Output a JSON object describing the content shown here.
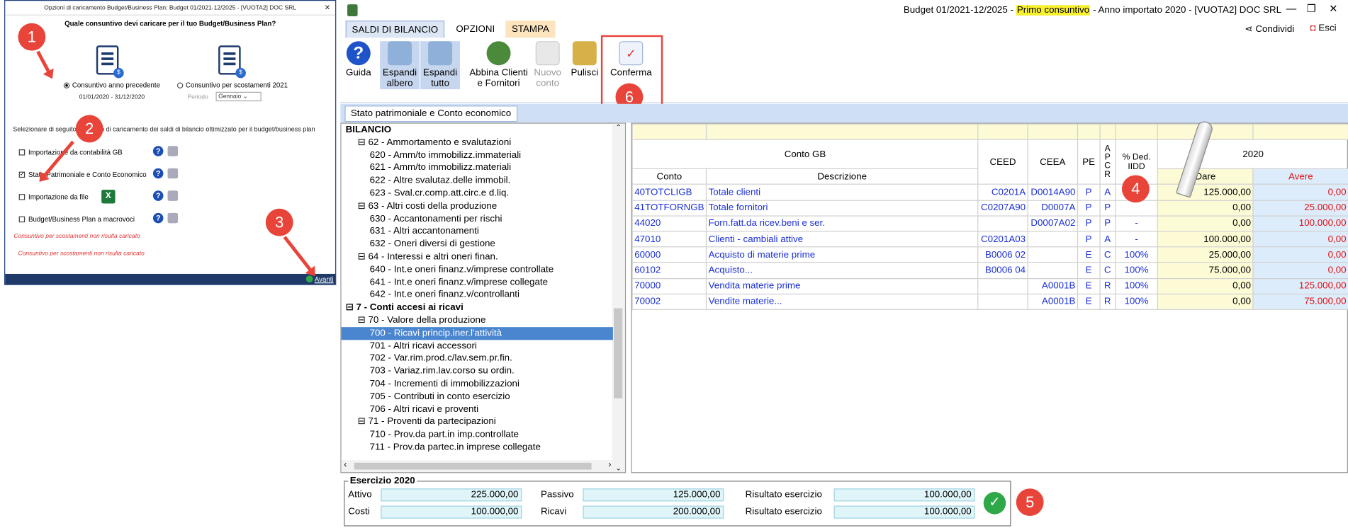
{
  "dialog": {
    "title": "Opzioni di caricamento Budget/Business Plan: Budget 01/2021-12/2025 - [VUOTA2] DOC SRL",
    "close": "×",
    "question": "Quale consuntivo devi caricare per il tuo Budget/Business Plan?",
    "option1_label": "Consuntivo anno precedente",
    "option1_dates": "01/01/2020 - 31/12/2020",
    "option2_label": "Consuntivo per scostamenti 2021",
    "periodo_label": "Periodo",
    "periodo_value": "Gennaio",
    "instruction": "Selezionare di seguito il metodo di caricamento dei saldi di bilancio ottimizzato per il budget/business plan",
    "options": [
      {
        "label": "Importazione da contabilità GB",
        "checked": false
      },
      {
        "label": "Stato Patrimoniale e Conto Economico",
        "checked": true
      },
      {
        "label": "Importazione da file",
        "checked": false
      },
      {
        "label": "Budget/Business Plan a macrovoci",
        "checked": false
      }
    ],
    "note1": "Consuntivo per scostamenti non risulta caricato",
    "note2": "Consuntivo per scostamenti non risulta caricato",
    "avanti": "Avanti"
  },
  "badges": [
    "1",
    "2",
    "3",
    "4",
    "5",
    "6"
  ],
  "app": {
    "title_pre": "Budget 01/2021-12/2025 - ",
    "title_highlight": "Primo consuntivo",
    "title_post": " - Anno importato 2020 - [VUOTA2] DOC SRL",
    "tabs": [
      "SALDI DI BILANCIO",
      "OPZIONI",
      "STAMPA"
    ],
    "share": "Condividi",
    "exit": "Esci",
    "ribbon": {
      "guida": "Guida",
      "espandi_albero": "Espandi albero",
      "espandi_tutto": "Espandi tutto",
      "abbina": "Abbina Clienti e Fornitori",
      "nuovo": "Nuovo conto",
      "pulisci": "Pulisci",
      "conferma": "Conferma"
    },
    "subtab": "Stato patrimoniale e Conto economico"
  },
  "tree": [
    {
      "text": "BILANCIO",
      "indent": 0,
      "bold": true
    },
    {
      "text": "⊟ 62 - Ammortamento e svalutazioni",
      "indent": 1
    },
    {
      "text": "620 - Amm/to immobilizz.immateriali",
      "indent": 2
    },
    {
      "text": "621 - Amm/to immobilizz.materiali",
      "indent": 2
    },
    {
      "text": "622 - Altre svalutaz.delle immobil.",
      "indent": 2
    },
    {
      "text": "623 - Sval.cr.comp.att.circ.e d.liq.",
      "indent": 2
    },
    {
      "text": "⊟ 63 - Altri costi della produzione",
      "indent": 1
    },
    {
      "text": "630 - Accantonamenti per rischi",
      "indent": 2
    },
    {
      "text": "631 - Altri accantonamenti",
      "indent": 2
    },
    {
      "text": "632 - Oneri diversi di gestione",
      "indent": 2
    },
    {
      "text": "⊟ 64 - Interessi e altri oneri finan.",
      "indent": 1
    },
    {
      "text": "640 - Int.e oneri finanz.v/imprese controllate",
      "indent": 2
    },
    {
      "text": "641 - Int.e oneri finanz.v/imprese collegate",
      "indent": 2
    },
    {
      "text": "642 - Int.e oneri finanz.v/controllanti",
      "indent": 2
    },
    {
      "text": "⊟ 7 - Conti accesi ai ricavi",
      "indent": 0,
      "bold": true
    },
    {
      "text": "⊟ 70 - Valore della produzione",
      "indent": 1
    },
    {
      "text": "700 - Ricavi princip.iner.l'attività",
      "indent": 2,
      "selected": true
    },
    {
      "text": "701 - Altri ricavi accessori",
      "indent": 2
    },
    {
      "text": "702 - Var.rim.prod.c/lav.sem.pr.fin.",
      "indent": 2
    },
    {
      "text": "703 - Variaz.rim.lav.corso su ordin.",
      "indent": 2
    },
    {
      "text": "704 - Incrementi di immobilizzazioni",
      "indent": 2
    },
    {
      "text": "705 - Contributi in conto esercizio",
      "indent": 2
    },
    {
      "text": "706 - Altri ricavi e proventi",
      "indent": 2
    },
    {
      "text": "⊟ 71 - Proventi da partecipazioni",
      "indent": 1
    },
    {
      "text": "710 - Prov.da part.in imp.controllate",
      "indent": 2
    },
    {
      "text": "711 - Prov.da partec.in imprese collegate",
      "indent": 2
    }
  ],
  "grid": {
    "header_top": {
      "conto_gb": "Conto GB",
      "ceed": "CEED",
      "ceea": "CEEA",
      "pe": "PE",
      "apcr": "A P C R",
      "ded": "% Ded. IIDD",
      "year": "2020"
    },
    "header_sub": {
      "conto": "Conto",
      "descrizione": "Descrizione",
      "dare": "Dare",
      "avere": "Avere"
    },
    "rows": [
      {
        "conto": "40TOTCLIGB",
        "desc": "Totale clienti",
        "ceed": "C0201A",
        "ceea": "D0014A90",
        "pe": "P",
        "apcr": "A",
        "ded": "",
        "dare": "125.000,00",
        "avere": "0,00"
      },
      {
        "conto": "41TOTFORNGB",
        "desc": "Totale fornitori",
        "ceed": "C0207A90",
        "ceea": "D0007A",
        "pe": "P",
        "apcr": "P",
        "ded": "",
        "dare": "0,00",
        "avere": "25.000,00"
      },
      {
        "conto": "44020",
        "desc": "Forn.fatt.da ricev.beni e ser.",
        "ceed": "",
        "ceea": "D0007A02",
        "pe": "P",
        "apcr": "P",
        "ded": "-",
        "dare": "0,00",
        "avere": "100.000,00"
      },
      {
        "conto": "47010",
        "desc": "Clienti - cambiali attive",
        "ceed": "C0201A03",
        "ceea": "",
        "pe": "P",
        "apcr": "A",
        "ded": "-",
        "dare": "100.000,00",
        "avere": "0,00"
      },
      {
        "conto": "60000",
        "desc": "Acquisto di materie prime",
        "ceed": "B0006 02",
        "ceea": "",
        "pe": "E",
        "apcr": "C",
        "ded": "100%",
        "dare": "25.000,00",
        "avere": "0,00"
      },
      {
        "conto": "60102",
        "desc": "Acquisto...",
        "ceed": "B0006 04",
        "ceea": "",
        "pe": "E",
        "apcr": "C",
        "ded": "100%",
        "dare": "75.000,00",
        "avere": "0,00"
      },
      {
        "conto": "70000",
        "desc": "Vendita materie prime",
        "ceed": "",
        "ceea": "A0001B",
        "pe": "E",
        "apcr": "R",
        "ded": "100%",
        "dare": "0,00",
        "avere": "125.000,00"
      },
      {
        "conto": "70002",
        "desc": "Vendite materie...",
        "ceed": "",
        "ceea": "A0001B",
        "pe": "E",
        "apcr": "R",
        "ded": "100%",
        "dare": "0,00",
        "avere": "75.000,00"
      }
    ]
  },
  "totals": {
    "legend": "Esercizio 2020",
    "attivo_label": "Attivo",
    "attivo": "225.000,00",
    "passivo_label": "Passivo",
    "passivo": "125.000,00",
    "ris1_label": "Risultato esercizio",
    "ris1": "100.000,00",
    "costi_label": "Costi",
    "costi": "100.000,00",
    "ricavi_label": "Ricavi",
    "ricavi": "200.000,00",
    "ris2_label": "Risultato esercizio",
    "ris2": "100.000,00"
  }
}
